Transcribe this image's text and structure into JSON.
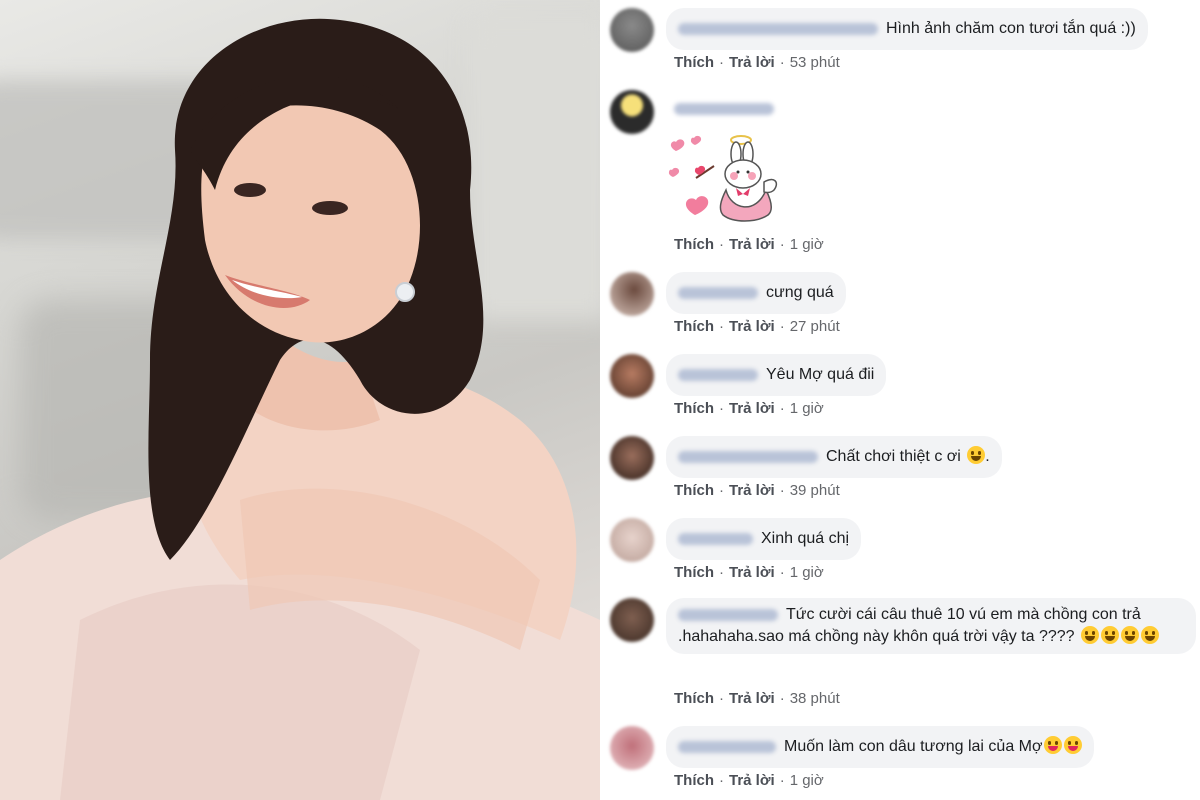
{
  "comments": [
    {
      "text": "Hình ảnh chăm con tươi tắn quá :))",
      "like": "Thích",
      "reply": "Trả lời",
      "time": "53 phút"
    },
    {
      "text": "",
      "like": "Thích",
      "reply": "Trả lời",
      "time": "1 giờ",
      "sticker": "angel-bunny-sticker"
    },
    {
      "text": "cưng quá",
      "like": "Thích",
      "reply": "Trả lời",
      "time": "27 phút"
    },
    {
      "text": "Yêu Mợ quá đii",
      "like": "Thích",
      "reply": "Trả lời",
      "time": "1 giờ"
    },
    {
      "text": "Chất chơi thiệt c ơi",
      "like": "Thích",
      "reply": "Trả lời",
      "time": "39 phút",
      "emoji": "grinning-emoji"
    },
    {
      "text": "Xinh quá chị",
      "like": "Thích",
      "reply": "Trả lời",
      "time": "1 giờ"
    },
    {
      "text": "Tức cười cái câu thuê 10 vú em mà chồng con trả .hahahaha.sao má chồng này khôn quá trời vậy ta ????",
      "like": "Thích",
      "reply": "Trả lời",
      "time": "38 phút",
      "emoji": "grinning-emoji"
    },
    {
      "text": "Muốn làm con dâu tương lai của Mợ",
      "like": "Thích",
      "reply": "Trả lời",
      "time": "1 giờ",
      "emoji": "tongue-emoji"
    }
  ],
  "colors": {
    "bubble": "#f2f3f5",
    "action_text": "#4b4f56",
    "time_text": "#65676b"
  }
}
